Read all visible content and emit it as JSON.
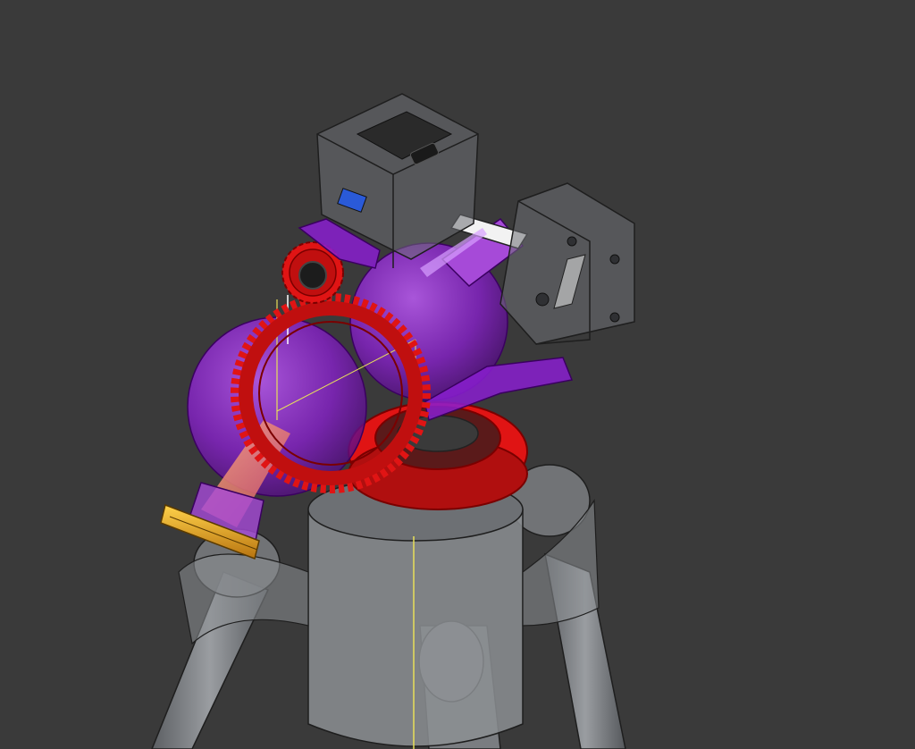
{
  "viewport": {
    "background": "#3a3a3a"
  },
  "model": {
    "parts": [
      {
        "name": "tripod-base",
        "color": "#8c8f93"
      },
      {
        "name": "rotation-ring-gear",
        "color": "#e01414"
      },
      {
        "name": "tilt-gear",
        "color": "#e01414"
      },
      {
        "name": "drive-pinion",
        "color": "#e01414"
      },
      {
        "name": "left-sphere",
        "color": "#8a1fd0"
      },
      {
        "name": "right-sphere",
        "color": "#8a1fd0"
      },
      {
        "name": "lens-ring",
        "color": "#e6a11a"
      },
      {
        "name": "laser-beam",
        "color": "#f08a5a"
      },
      {
        "name": "top-enclosure",
        "color": "#6e7074"
      },
      {
        "name": "side-enclosure",
        "color": "#6e7074"
      },
      {
        "name": "axis-line",
        "color": "#e8e05a"
      }
    ]
  }
}
